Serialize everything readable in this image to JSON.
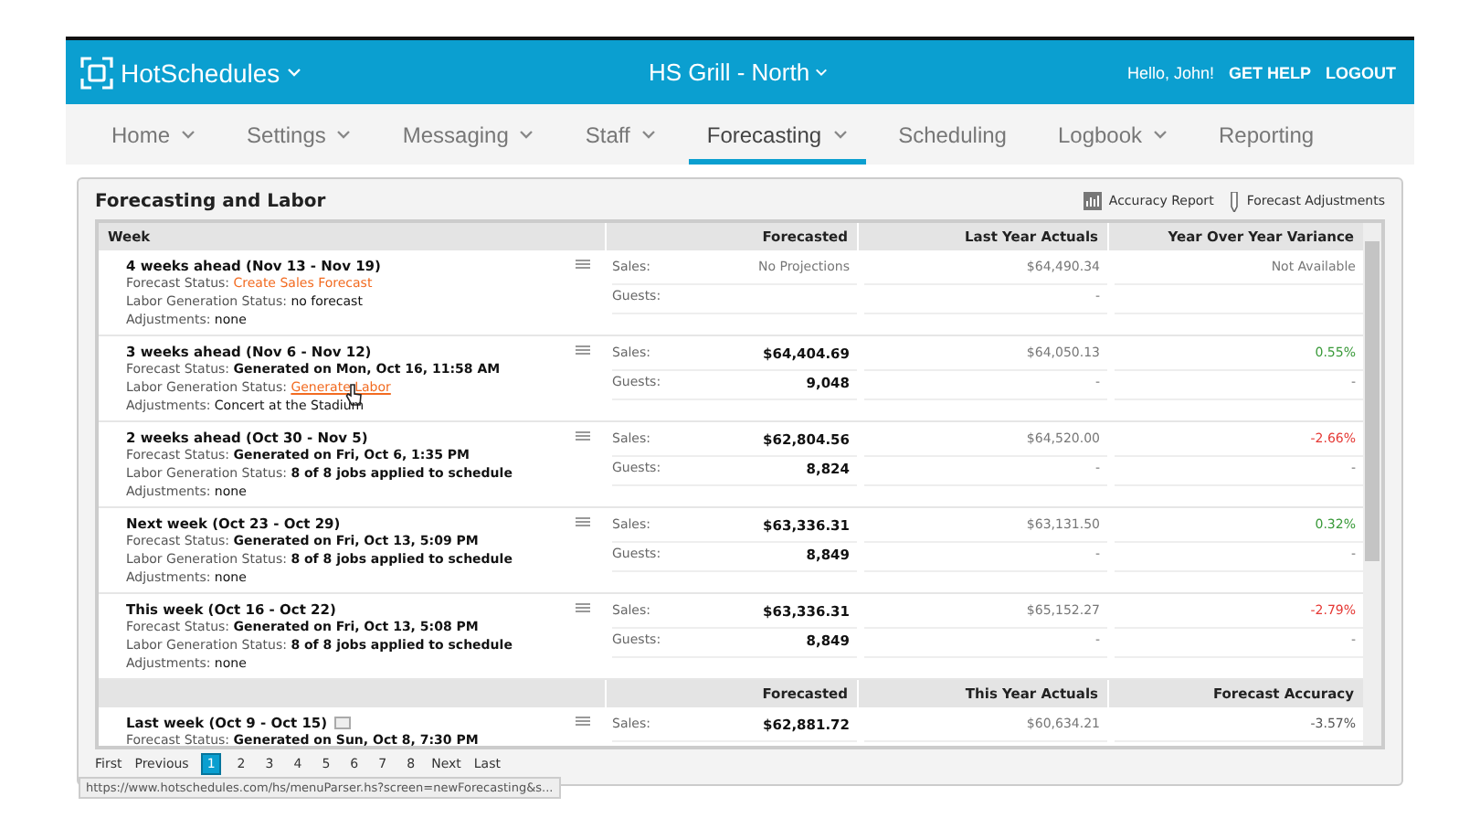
{
  "header": {
    "brand": "HotSchedules",
    "location": "HS Grill - North",
    "greeting": "Hello, John!",
    "links": [
      "GET HELP",
      "LOGOUT"
    ]
  },
  "nav": [
    {
      "label": "Home",
      "dropdown": true,
      "selected": false
    },
    {
      "label": "Settings",
      "dropdown": true,
      "selected": false
    },
    {
      "label": "Messaging",
      "dropdown": true,
      "selected": false
    },
    {
      "label": "Staff",
      "dropdown": true,
      "selected": false
    },
    {
      "label": "Forecasting",
      "dropdown": true,
      "selected": true
    },
    {
      "label": "Scheduling",
      "dropdown": false,
      "selected": false
    },
    {
      "label": "Logbook",
      "dropdown": true,
      "selected": false
    },
    {
      "label": "Reporting",
      "dropdown": false,
      "selected": false
    }
  ],
  "panel": {
    "title": "Forecasting and Labor",
    "actions": [
      {
        "label": "Accuracy Report",
        "kind": "chart"
      },
      {
        "label": "Forecast Adjustments",
        "kind": "pencil"
      }
    ]
  },
  "sections": [
    {
      "columns": [
        "Week",
        "Forecasted",
        "Last Year Actuals",
        "Year Over Year Variance"
      ],
      "rows": [
        {
          "title": "4 weeks ahead (Nov 13 - Nov 19)",
          "title_note": false,
          "fields": [
            {
              "label": "Forecast Status:",
              "value": "Create Sales Forecast",
              "kind": "link"
            },
            {
              "label": "Labor Generation Status:",
              "value": "no forecast",
              "kind": "plain"
            },
            {
              "label": "Adjustments:",
              "value": "none",
              "kind": "plain"
            }
          ],
          "sales": {
            "label": "Sales:",
            "forecast": "No Projections",
            "projected": false,
            "actual": "$64,490.34",
            "variance": "Not Available",
            "color": "#777777"
          },
          "guests": {
            "label": "Guests:",
            "actual": "-"
          }
        },
        {
          "title": "3 weeks ahead (Nov 6 - Nov 12)",
          "title_note": false,
          "fields": [
            {
              "label": "Forecast Status:",
              "value": "Generated on Mon, Oct 16, 11:58 AM",
              "kind": "bold"
            },
            {
              "label": "Labor Generation Status:",
              "value": "Generate Labor",
              "kind": "link",
              "hovered": true
            },
            {
              "label": "Adjustments:",
              "value": "Concert at the Stadium",
              "kind": "plain"
            }
          ],
          "sales": {
            "label": "Sales:",
            "forecast": "$64,404.69",
            "projected": true,
            "actual": "$64,050.13",
            "variance": "0.55%",
            "color": "#3a9a3a"
          },
          "guests": {
            "label": "Guests:",
            "forecast": "9,048",
            "actual": "-",
            "variance": "-"
          }
        },
        {
          "title": "2 weeks ahead (Oct 30 - Nov 5)",
          "title_note": false,
          "fields": [
            {
              "label": "Forecast Status:",
              "value": "Generated on Fri, Oct 6, 1:35 PM",
              "kind": "bold"
            },
            {
              "label": "Labor Generation Status:",
              "value": "8 of 8 jobs applied to schedule",
              "kind": "bold"
            },
            {
              "label": "Adjustments:",
              "value": "none",
              "kind": "plain"
            }
          ],
          "sales": {
            "label": "Sales:",
            "forecast": "$62,804.56",
            "projected": true,
            "actual": "$64,520.00",
            "variance": "-2.66%",
            "color": "#e53935"
          },
          "guests": {
            "label": "Guests:",
            "forecast": "8,824",
            "actual": "-",
            "variance": "-"
          }
        },
        {
          "title": "Next week (Oct 23 - Oct 29)",
          "title_note": false,
          "fields": [
            {
              "label": "Forecast Status:",
              "value": "Generated on Fri, Oct 13, 5:09 PM",
              "kind": "bold"
            },
            {
              "label": "Labor Generation Status:",
              "value": "8 of 8 jobs applied to schedule",
              "kind": "bold"
            },
            {
              "label": "Adjustments:",
              "value": "none",
              "kind": "plain"
            }
          ],
          "sales": {
            "label": "Sales:",
            "forecast": "$63,336.31",
            "projected": true,
            "actual": "$63,131.50",
            "variance": "0.32%",
            "color": "#3a9a3a"
          },
          "guests": {
            "label": "Guests:",
            "forecast": "8,849",
            "actual": "-",
            "variance": "-"
          }
        },
        {
          "title": "This week (Oct 16 - Oct 22)",
          "title_note": false,
          "fields": [
            {
              "label": "Forecast Status:",
              "value": "Generated on Fri, Oct 13, 5:08 PM",
              "kind": "bold"
            },
            {
              "label": "Labor Generation Status:",
              "value": "8 of 8 jobs applied to schedule",
              "kind": "bold"
            },
            {
              "label": "Adjustments:",
              "value": "none",
              "kind": "plain"
            }
          ],
          "sales": {
            "label": "Sales:",
            "forecast": "$63,336.31",
            "projected": true,
            "actual": "$65,152.27",
            "variance": "-2.79%",
            "color": "#e53935"
          },
          "guests": {
            "label": "Guests:",
            "forecast": "8,849",
            "actual": "-",
            "variance": "-"
          }
        }
      ]
    },
    {
      "columns": [
        "Forecasted",
        "This Year Actuals",
        "Forecast Accuracy"
      ],
      "rows": [
        {
          "title": "Last week (Oct 9 - Oct 15)",
          "title_note": true,
          "fields": [
            {
              "label": "Forecast Status:",
              "value": "Generated on Sun, Oct 8, 7:30 PM",
              "kind": "bold"
            }
          ],
          "sales": {
            "label": "Sales:",
            "forecast": "$62,881.72",
            "projected": true,
            "actual": "$60,634.21",
            "variance": "-3.57%",
            "color": "#555555"
          }
        }
      ]
    }
  ],
  "pagination": {
    "prev": [
      "First",
      "Previous"
    ],
    "pages": [
      {
        "label": "1",
        "selected": true
      },
      {
        "label": "2",
        "selected": false
      },
      {
        "label": "3",
        "selected": false
      },
      {
        "label": "4",
        "selected": false
      },
      {
        "label": "5",
        "selected": false
      },
      {
        "label": "6",
        "selected": false
      },
      {
        "label": "7",
        "selected": false
      },
      {
        "label": "8",
        "selected": false
      }
    ],
    "next": [
      "Next",
      "Last"
    ]
  },
  "status_url": "https://www.hotschedules.com/hs/menuParser.hs?screen=newForecasting&s..."
}
